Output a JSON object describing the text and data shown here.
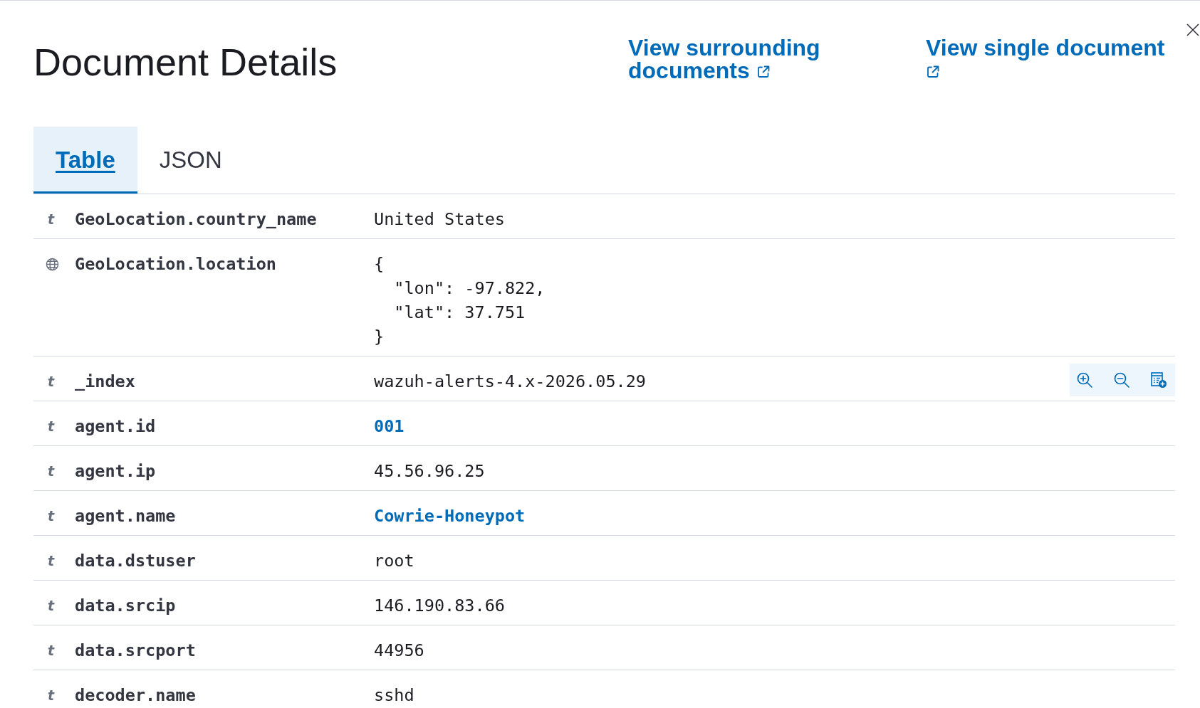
{
  "flyout": {
    "title": "Document Details",
    "links": [
      {
        "label": "View surrounding documents"
      },
      {
        "label": "View single document"
      }
    ]
  },
  "tabs": [
    {
      "label": "Table",
      "selected": true
    },
    {
      "label": "JSON",
      "selected": false
    }
  ],
  "fields": [
    {
      "kind": "string",
      "type_icon": "t",
      "name": "GeoLocation.country_name",
      "value": "United States",
      "link": false,
      "hovered": false
    },
    {
      "kind": "geo_point",
      "name": "GeoLocation.location",
      "value": "{\n  \"lon\": -97.822,\n  \"lat\": 37.751\n}",
      "link": false,
      "hovered": false
    },
    {
      "kind": "string",
      "type_icon": "t",
      "name": "_index",
      "value": "wazuh-alerts-4.x-2026.05.29",
      "link": false,
      "hovered": true
    },
    {
      "kind": "string",
      "type_icon": "t",
      "name": "agent.id",
      "value": "001",
      "link": true,
      "hovered": false
    },
    {
      "kind": "string",
      "type_icon": "t",
      "name": "agent.ip",
      "value": "45.56.96.25",
      "link": false,
      "hovered": false
    },
    {
      "kind": "string",
      "type_icon": "t",
      "name": "agent.name",
      "value": "Cowrie-Honeypot",
      "link": true,
      "hovered": false
    },
    {
      "kind": "string",
      "type_icon": "t",
      "name": "data.dstuser",
      "value": "root",
      "link": false,
      "hovered": false
    },
    {
      "kind": "string",
      "type_icon": "t",
      "name": "data.srcip",
      "value": "146.190.83.66",
      "link": false,
      "hovered": false
    },
    {
      "kind": "string",
      "type_icon": "t",
      "name": "data.srcport",
      "value": "44956",
      "link": false,
      "hovered": false
    },
    {
      "kind": "string",
      "type_icon": "t",
      "name": "decoder.name",
      "value": "sshd",
      "link": false,
      "hovered": false
    }
  ]
}
